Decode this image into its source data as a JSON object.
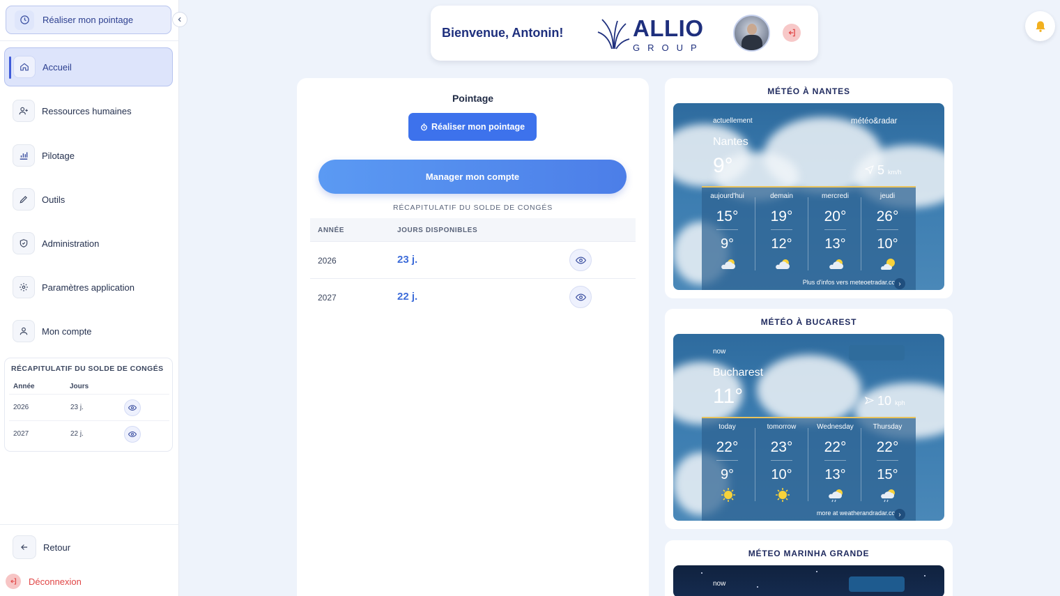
{
  "sidebar": {
    "clock_label": "Réaliser mon pointage",
    "collapse_icon": "chevron-left-icon",
    "items": [
      {
        "label": "Accueil",
        "icon": "home-icon"
      },
      {
        "label": "Ressources humaines",
        "icon": "users-icon"
      },
      {
        "label": "Pilotage",
        "icon": "bar-chart-icon"
      },
      {
        "label": "Outils",
        "icon": "pencil-icon"
      },
      {
        "label": "Administration",
        "icon": "shield-icon"
      },
      {
        "label": "Paramètres application",
        "icon": "gear-icon"
      },
      {
        "label": "Mon compte",
        "icon": "user-icon"
      }
    ],
    "recap": {
      "title": "RÉCAPITULATIF DU SOLDE DE CONGÉS",
      "col_year": "Année",
      "col_days": "Jours",
      "rows": [
        {
          "year": "2026",
          "days": "23 j."
        },
        {
          "year": "2027",
          "days": "22 j."
        }
      ]
    },
    "back_label": "Retour",
    "logout_label": "Déconnexion"
  },
  "header": {
    "welcome": "Bienvenue, Antonin!",
    "logo_word": "ALLIO",
    "logo_sub": "GROUP"
  },
  "pointage": {
    "title": "Pointage",
    "clock_button": "Réaliser mon pointage",
    "manager_button": "Manager mon compte",
    "recap_title": "RÉCAPITULATIF DU SOLDE DE CONGÉS",
    "col_year": "ANNÉE",
    "col_days": "JOURS DISPONIBLES",
    "rows": [
      {
        "year": "2026",
        "days": "23 j."
      },
      {
        "year": "2027",
        "days": "22 j."
      }
    ]
  },
  "weather": [
    {
      "title": "MÉTÉO À NANTES",
      "now_label": "actuellement",
      "brand": "météo&radar",
      "city": "Nantes",
      "temp": "9°",
      "wind_value": "5",
      "wind_unit": "km/h",
      "days": [
        {
          "day": "aujourd'hui",
          "hi": "15°",
          "lo": "9°",
          "icon": "partly-cloudy-icon"
        },
        {
          "day": "demain",
          "hi": "19°",
          "lo": "12°",
          "icon": "sun-cloud-icon"
        },
        {
          "day": "mercredi",
          "hi": "20°",
          "lo": "13°",
          "icon": "partly-cloudy-icon"
        },
        {
          "day": "jeudi",
          "hi": "26°",
          "lo": "10°",
          "icon": "sunny-cloud-icon"
        }
      ],
      "more": "Plus d'infos vers meteoetradar.com"
    },
    {
      "title": "MÉTÉO À BUCAREST",
      "now_label": "now",
      "brand": "",
      "city": "Bucharest",
      "temp": "11°",
      "wind_value": "10",
      "wind_unit": "kph",
      "days": [
        {
          "day": "today",
          "hi": "22°",
          "lo": "9°",
          "icon": "sun-icon"
        },
        {
          "day": "tomorrow",
          "hi": "23°",
          "lo": "10°",
          "icon": "sun-icon"
        },
        {
          "day": "Wednesday",
          "hi": "22°",
          "lo": "13°",
          "icon": "rain-sun-icon"
        },
        {
          "day": "Thursday",
          "hi": "22°",
          "lo": "15°",
          "icon": "rain-sun-icon"
        }
      ],
      "more": "more at weatherandradar.com"
    },
    {
      "title": "MÉTEO MARINHA GRANDE",
      "now_label": "now"
    }
  ],
  "colors": {
    "accent": "#3d72ec",
    "brand_navy": "#1e2f7d",
    "danger": "#e04545"
  }
}
